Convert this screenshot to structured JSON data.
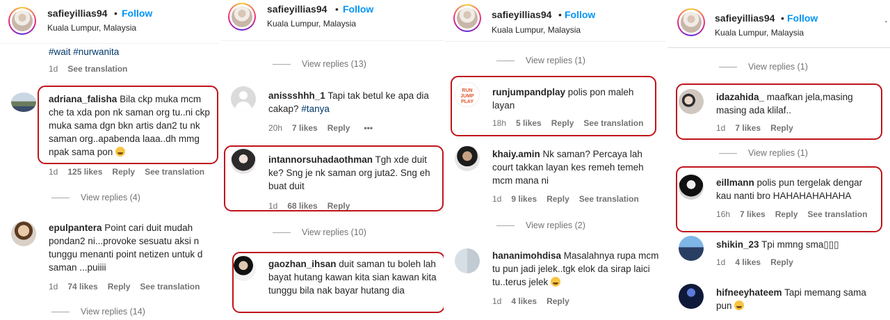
{
  "header": {
    "username": "safieyillias94",
    "dot": "•",
    "follow": "Follow",
    "location": "Kuala Lumpur, Malaysia",
    "more": "·"
  },
  "panel1": {
    "top_hashtags": "#wait #nurwanita",
    "top_meta": {
      "time": "1d",
      "translate": "See translation"
    },
    "c1": {
      "user": "adriana_falisha",
      "text": "Bila ckp muka mcm che ta xda pon nk saman org tu..ni ckp muka sama dgn bkn artis dan2 tu nk saman org..apabenda laaa..dh mmg npak sama pon",
      "time": "1d",
      "likes": "125 likes",
      "reply": "Reply",
      "translate": "See translation"
    },
    "vr1": "View replies (4)",
    "c2": {
      "user": "epulpantera",
      "text": "Point cari duit mudah pondan2 ni...provoke sesuatu aksi n tunggu menanti point netizen untuk d saman ...puiiii",
      "time": "1d",
      "likes": "74 likes",
      "reply": "Reply",
      "translate": "See translation"
    },
    "vr2": "View replies (14)"
  },
  "panel2": {
    "vr0": "View replies (13)",
    "c1": {
      "user": "anissshhh_1",
      "text": "Tapi tak betul ke apa dia cakap?",
      "tag": "#tanya",
      "time": "20h",
      "likes": "7 likes",
      "reply": "Reply",
      "more": "•••"
    },
    "c2": {
      "user": "intannorsuhadaothman",
      "text": "Tgh xde duit ke? Sng je nk saman org juta2. Sng eh buat duit",
      "time": "1d",
      "likes": "68 likes",
      "reply": "Reply"
    },
    "vr1": "View replies (10)",
    "c3": {
      "user": "gaozhan_ihsan",
      "text": "duit saman tu boleh lah bayat hutang kawan kita sian kawan kita tunggu bila nak bayar hutang dia"
    }
  },
  "panel3": {
    "vr0": "View replies (1)",
    "c1": {
      "user": "runjumpandplay",
      "text": "polis pon maleh layan",
      "time": "18h",
      "likes": "5 likes",
      "reply": "Reply",
      "translate": "See translation",
      "logo_text": "RUN JUMP PLAY"
    },
    "c2": {
      "user": "khaiy.amin",
      "text": "Nk saman? Percaya lah court takkan layan kes remeh temeh mcm mana ni",
      "time": "1d",
      "likes": "9 likes",
      "reply": "Reply",
      "translate": "See translation"
    },
    "vr1": "View replies (2)",
    "c3": {
      "user": "hananimohdisa",
      "text": "Masalahnya rupa mcm tu pun jadi jelek..tgk elok da sirap laici tu..terus jelek",
      "time": "1d",
      "likes": "4 likes",
      "reply": "Reply"
    }
  },
  "panel4": {
    "vr0": "View replies (1)",
    "c1": {
      "user": "idazahida_",
      "text": "maafkan jela,masing masing ada klilaf..",
      "time": "1d",
      "likes": "7 likes",
      "reply": "Reply"
    },
    "vr1": "View replies (1)",
    "c2": {
      "user": "eillmann",
      "text": "polis pun tergelak dengar kau nanti bro HAHAHAHAHAHA",
      "time": "16h",
      "likes": "7 likes",
      "reply": "Reply",
      "translate": "See translation"
    },
    "c3": {
      "user": "shikin_23",
      "text": "Tpi mmng sma▯▯▯",
      "time": "1d",
      "likes": "4 likes",
      "reply": "Reply"
    },
    "c4": {
      "user": "hifneeyhateem",
      "text": "Tapi memang sama pun"
    }
  },
  "colors": {
    "accent": "#0095f6",
    "highlight": "#c0141b",
    "muted": "#737373"
  }
}
